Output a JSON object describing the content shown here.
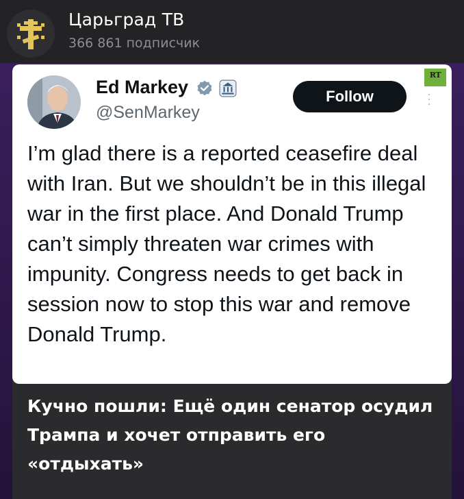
{
  "channel": {
    "name": "Царьград ТВ",
    "subscribers": "366 861 подписчик",
    "avatar_icon": "orthodox-cross-icon"
  },
  "tweet": {
    "author_name": "Ed Markey",
    "author_handle": "@SenMarkey",
    "follow_label": "Follow",
    "text": "I’m glad there is a reported ceasefire deal with Iran. But we shouldn’t be in this illegal war in the first place. And Donald Trump can’t simply threaten war crimes with impunity. Congress needs to get back in session now to stop this war and remove Donald Trump.",
    "verified_icon": "verified-badge-icon",
    "gov_icon": "government-building-icon",
    "watermark": "RT"
  },
  "post": {
    "caption": "Кучно пошли: Ещё один сенатор осудил Трампа и хочет отправить его «отдыхать»"
  },
  "colors": {
    "follow_button_bg": "#0f1419",
    "verified_blue": "#1d9bf0",
    "rt_green": "#6fb03c",
    "caption_text": "#ffffff"
  }
}
